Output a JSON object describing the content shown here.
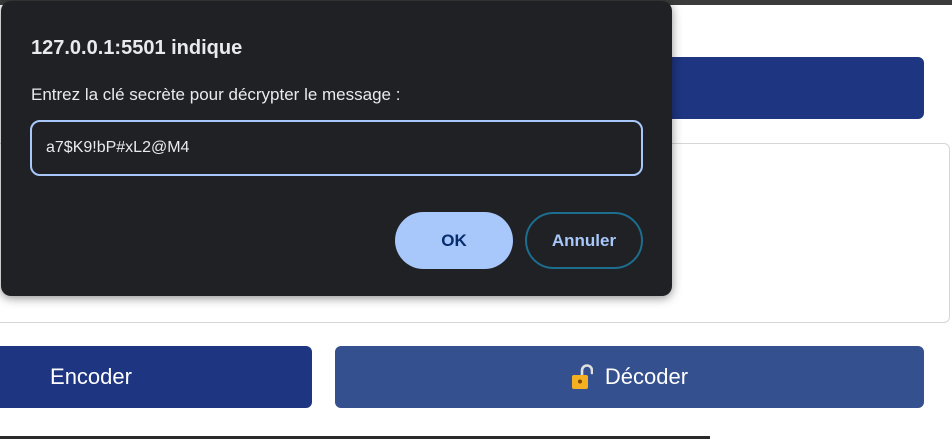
{
  "dialog": {
    "title": "127.0.0.1:5501 indique",
    "message": "Entrez la clé secrète pour décrypter le message :",
    "input_value": "a7$K9!bP#xL2@M4",
    "ok_label": "OK",
    "cancel_label": "Annuler"
  },
  "page": {
    "encode_label": "Encoder",
    "decode_label": "Décoder",
    "decode_icon": "unlock-icon"
  },
  "colors": {
    "primary_button": "#1e3582",
    "decode_button": "#34508e",
    "dialog_bg": "#202124",
    "dialog_accent": "#a8c7fa"
  }
}
